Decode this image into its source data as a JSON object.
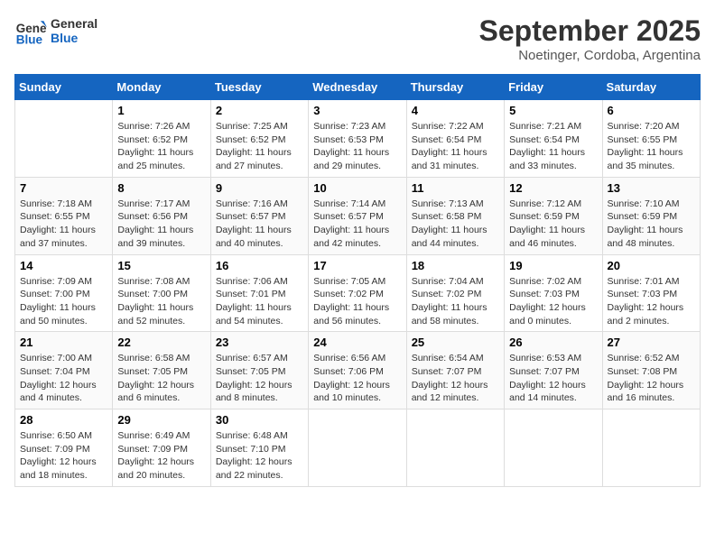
{
  "header": {
    "logo_line1": "General",
    "logo_line2": "Blue",
    "month": "September 2025",
    "location": "Noetinger, Cordoba, Argentina"
  },
  "days_of_week": [
    "Sunday",
    "Monday",
    "Tuesday",
    "Wednesday",
    "Thursday",
    "Friday",
    "Saturday"
  ],
  "weeks": [
    [
      {
        "day": "",
        "content": ""
      },
      {
        "day": "1",
        "content": "Sunrise: 7:26 AM\nSunset: 6:52 PM\nDaylight: 11 hours\nand 25 minutes."
      },
      {
        "day": "2",
        "content": "Sunrise: 7:25 AM\nSunset: 6:52 PM\nDaylight: 11 hours\nand 27 minutes."
      },
      {
        "day": "3",
        "content": "Sunrise: 7:23 AM\nSunset: 6:53 PM\nDaylight: 11 hours\nand 29 minutes."
      },
      {
        "day": "4",
        "content": "Sunrise: 7:22 AM\nSunset: 6:54 PM\nDaylight: 11 hours\nand 31 minutes."
      },
      {
        "day": "5",
        "content": "Sunrise: 7:21 AM\nSunset: 6:54 PM\nDaylight: 11 hours\nand 33 minutes."
      },
      {
        "day": "6",
        "content": "Sunrise: 7:20 AM\nSunset: 6:55 PM\nDaylight: 11 hours\nand 35 minutes."
      }
    ],
    [
      {
        "day": "7",
        "content": "Sunrise: 7:18 AM\nSunset: 6:55 PM\nDaylight: 11 hours\nand 37 minutes."
      },
      {
        "day": "8",
        "content": "Sunrise: 7:17 AM\nSunset: 6:56 PM\nDaylight: 11 hours\nand 39 minutes."
      },
      {
        "day": "9",
        "content": "Sunrise: 7:16 AM\nSunset: 6:57 PM\nDaylight: 11 hours\nand 40 minutes."
      },
      {
        "day": "10",
        "content": "Sunrise: 7:14 AM\nSunset: 6:57 PM\nDaylight: 11 hours\nand 42 minutes."
      },
      {
        "day": "11",
        "content": "Sunrise: 7:13 AM\nSunset: 6:58 PM\nDaylight: 11 hours\nand 44 minutes."
      },
      {
        "day": "12",
        "content": "Sunrise: 7:12 AM\nSunset: 6:59 PM\nDaylight: 11 hours\nand 46 minutes."
      },
      {
        "day": "13",
        "content": "Sunrise: 7:10 AM\nSunset: 6:59 PM\nDaylight: 11 hours\nand 48 minutes."
      }
    ],
    [
      {
        "day": "14",
        "content": "Sunrise: 7:09 AM\nSunset: 7:00 PM\nDaylight: 11 hours\nand 50 minutes."
      },
      {
        "day": "15",
        "content": "Sunrise: 7:08 AM\nSunset: 7:00 PM\nDaylight: 11 hours\nand 52 minutes."
      },
      {
        "day": "16",
        "content": "Sunrise: 7:06 AM\nSunset: 7:01 PM\nDaylight: 11 hours\nand 54 minutes."
      },
      {
        "day": "17",
        "content": "Sunrise: 7:05 AM\nSunset: 7:02 PM\nDaylight: 11 hours\nand 56 minutes."
      },
      {
        "day": "18",
        "content": "Sunrise: 7:04 AM\nSunset: 7:02 PM\nDaylight: 11 hours\nand 58 minutes."
      },
      {
        "day": "19",
        "content": "Sunrise: 7:02 AM\nSunset: 7:03 PM\nDaylight: 12 hours\nand 0 minutes."
      },
      {
        "day": "20",
        "content": "Sunrise: 7:01 AM\nSunset: 7:03 PM\nDaylight: 12 hours\nand 2 minutes."
      }
    ],
    [
      {
        "day": "21",
        "content": "Sunrise: 7:00 AM\nSunset: 7:04 PM\nDaylight: 12 hours\nand 4 minutes."
      },
      {
        "day": "22",
        "content": "Sunrise: 6:58 AM\nSunset: 7:05 PM\nDaylight: 12 hours\nand 6 minutes."
      },
      {
        "day": "23",
        "content": "Sunrise: 6:57 AM\nSunset: 7:05 PM\nDaylight: 12 hours\nand 8 minutes."
      },
      {
        "day": "24",
        "content": "Sunrise: 6:56 AM\nSunset: 7:06 PM\nDaylight: 12 hours\nand 10 minutes."
      },
      {
        "day": "25",
        "content": "Sunrise: 6:54 AM\nSunset: 7:07 PM\nDaylight: 12 hours\nand 12 minutes."
      },
      {
        "day": "26",
        "content": "Sunrise: 6:53 AM\nSunset: 7:07 PM\nDaylight: 12 hours\nand 14 minutes."
      },
      {
        "day": "27",
        "content": "Sunrise: 6:52 AM\nSunset: 7:08 PM\nDaylight: 12 hours\nand 16 minutes."
      }
    ],
    [
      {
        "day": "28",
        "content": "Sunrise: 6:50 AM\nSunset: 7:09 PM\nDaylight: 12 hours\nand 18 minutes."
      },
      {
        "day": "29",
        "content": "Sunrise: 6:49 AM\nSunset: 7:09 PM\nDaylight: 12 hours\nand 20 minutes."
      },
      {
        "day": "30",
        "content": "Sunrise: 6:48 AM\nSunset: 7:10 PM\nDaylight: 12 hours\nand 22 minutes."
      },
      {
        "day": "",
        "content": ""
      },
      {
        "day": "",
        "content": ""
      },
      {
        "day": "",
        "content": ""
      },
      {
        "day": "",
        "content": ""
      }
    ]
  ]
}
